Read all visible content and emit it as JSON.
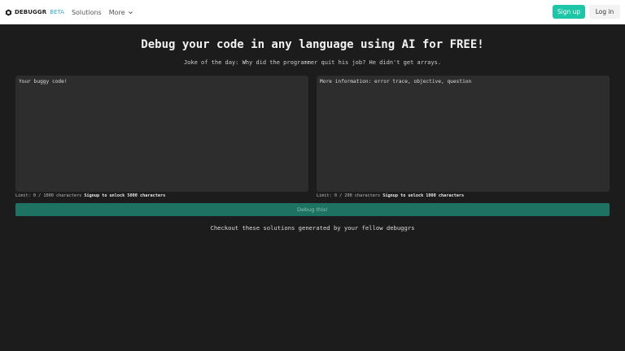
{
  "nav": {
    "brand": "DEBUGGR",
    "beta": "BETA",
    "links": [
      "Solutions",
      "More"
    ],
    "signup": "Sign up",
    "login": "Log in"
  },
  "main": {
    "title": "Debug your code in any language using AI for FREE!",
    "joke": "Joke of the day: Why did the programmer quit his job? He didn't get arrays.",
    "code_placeholder": "Your buggy code!",
    "info_placeholder": "More information: error trace, objective, question",
    "code_limit": "Limit: 0 / 1000 characters",
    "code_unlock": "Signup to unlock 5000 characters",
    "info_limit": "Limit: 0 / 200 characters",
    "info_unlock": "Signup to unlock 1000 characters",
    "debug_button": "Debug this!",
    "checkout": "Checkout these solutions generated by your fellow debuggrs"
  },
  "colors": {
    "accent": "#1cc6a7",
    "debug_button": "#1d7262",
    "background": "#1c1c1c",
    "textarea": "#2d2d2d"
  }
}
